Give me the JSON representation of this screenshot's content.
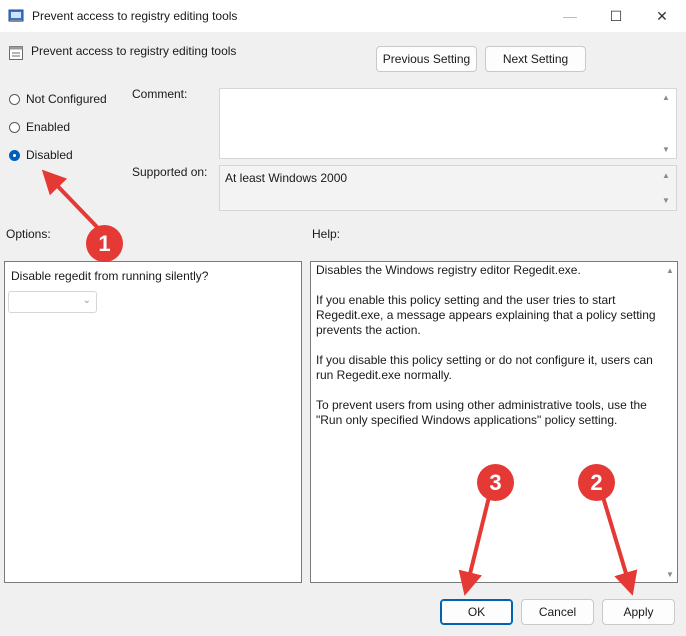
{
  "window": {
    "title": "Prevent access to registry editing tools",
    "minimize_glyph": "—",
    "maximize_glyph": "☐",
    "close_glyph": "✕",
    "app_icon": "policy-window-icon"
  },
  "header": {
    "policy_name": "Prevent access to registry editing tools",
    "policy_icon": "policy-setting-icon",
    "previous_label": "Previous Setting",
    "next_label": "Next Setting"
  },
  "state_options": [
    {
      "label": "Not Configured",
      "checked": false
    },
    {
      "label": "Enabled",
      "checked": false
    },
    {
      "label": "Disabled",
      "checked": true
    }
  ],
  "comment": {
    "label": "Comment:",
    "value": ""
  },
  "supported_on": {
    "label": "Supported on:",
    "value": "At least Windows 2000"
  },
  "options": {
    "label": "Options:",
    "setting_text": "Disable regedit from running silently?",
    "dropdown_value": ""
  },
  "help": {
    "label": "Help:",
    "paragraphs": [
      "Disables the Windows registry editor Regedit.exe.",
      "If you enable this policy setting and the user tries to start Regedit.exe, a message appears explaining that a policy setting prevents the action.",
      "If you disable this policy setting or do not configure it, users can run Regedit.exe normally.",
      "To prevent users from using other administrative tools, use the \"Run only specified Windows applications\" policy setting."
    ]
  },
  "footer": {
    "ok_label": "OK",
    "cancel_label": "Cancel",
    "apply_label": "Apply"
  },
  "annotations": [
    {
      "number": "1",
      "points_to": "Disabled"
    },
    {
      "number": "2",
      "points_to": "Apply"
    },
    {
      "number": "3",
      "points_to": "OK"
    }
  ],
  "colors": {
    "annotation_red": "#e53935",
    "accent_blue": "#005fb8",
    "window_bg": "#f0f0f0"
  }
}
